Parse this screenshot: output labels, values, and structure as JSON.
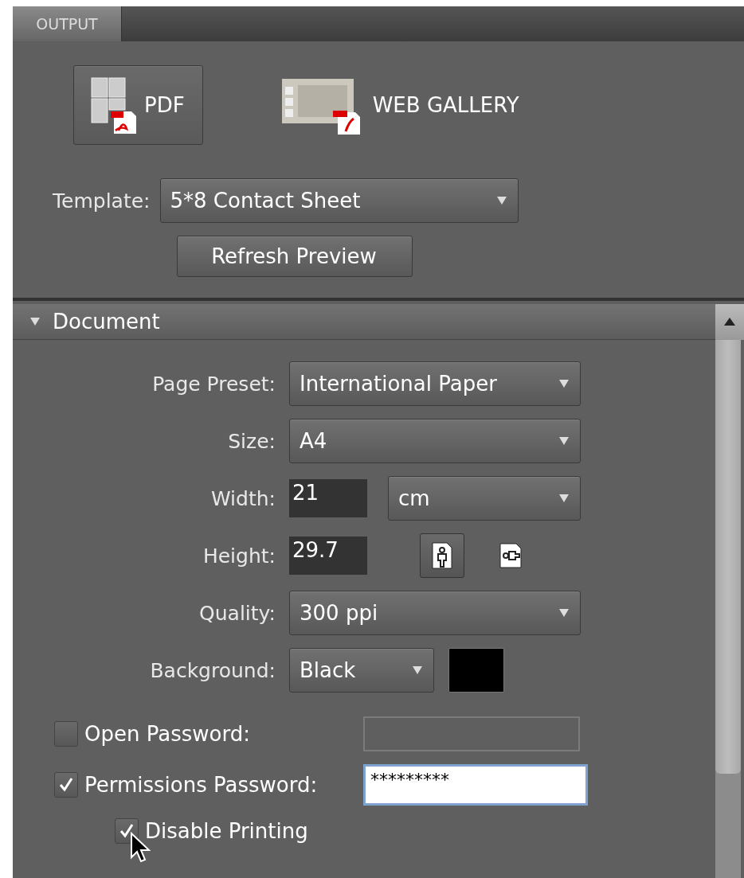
{
  "tab": {
    "label": "OUTPUT",
    "selected": true
  },
  "output_types": [
    {
      "kind": "pdf",
      "label": "PDF",
      "selected": true
    },
    {
      "kind": "web",
      "label": "WEB GALLERY",
      "selected": false
    }
  ],
  "template": {
    "label": "Template:",
    "value": "5*8 Contact Sheet"
  },
  "refresh_button": "Refresh Preview",
  "section": {
    "title": "Document",
    "expanded": true
  },
  "fields": [
    {
      "kind": "select",
      "label": "Page Preset:",
      "value": "International Paper"
    },
    {
      "kind": "select",
      "label": "Size:",
      "value": "A4"
    },
    {
      "kind": "number_unit",
      "label": "Width:",
      "value": "21",
      "unit": "cm"
    },
    {
      "kind": "number_orientation",
      "label": "Height:",
      "value": "29.7",
      "orientations": [
        {
          "kind": "portrait",
          "selected": true
        },
        {
          "kind": "landscape",
          "selected": false
        }
      ]
    },
    {
      "kind": "select",
      "label": "Quality:",
      "value": "300 ppi"
    },
    {
      "kind": "color_select",
      "label": "Background:",
      "value": "Black",
      "color": "#000000"
    }
  ],
  "passwords": [
    {
      "label": "Open Password:",
      "checked": false,
      "focused": false
    },
    {
      "label": "Permissions Password:",
      "checked": true,
      "focused": true,
      "value": "*********"
    }
  ],
  "disable_printing": {
    "label": "Disable Printing",
    "checked": true
  }
}
